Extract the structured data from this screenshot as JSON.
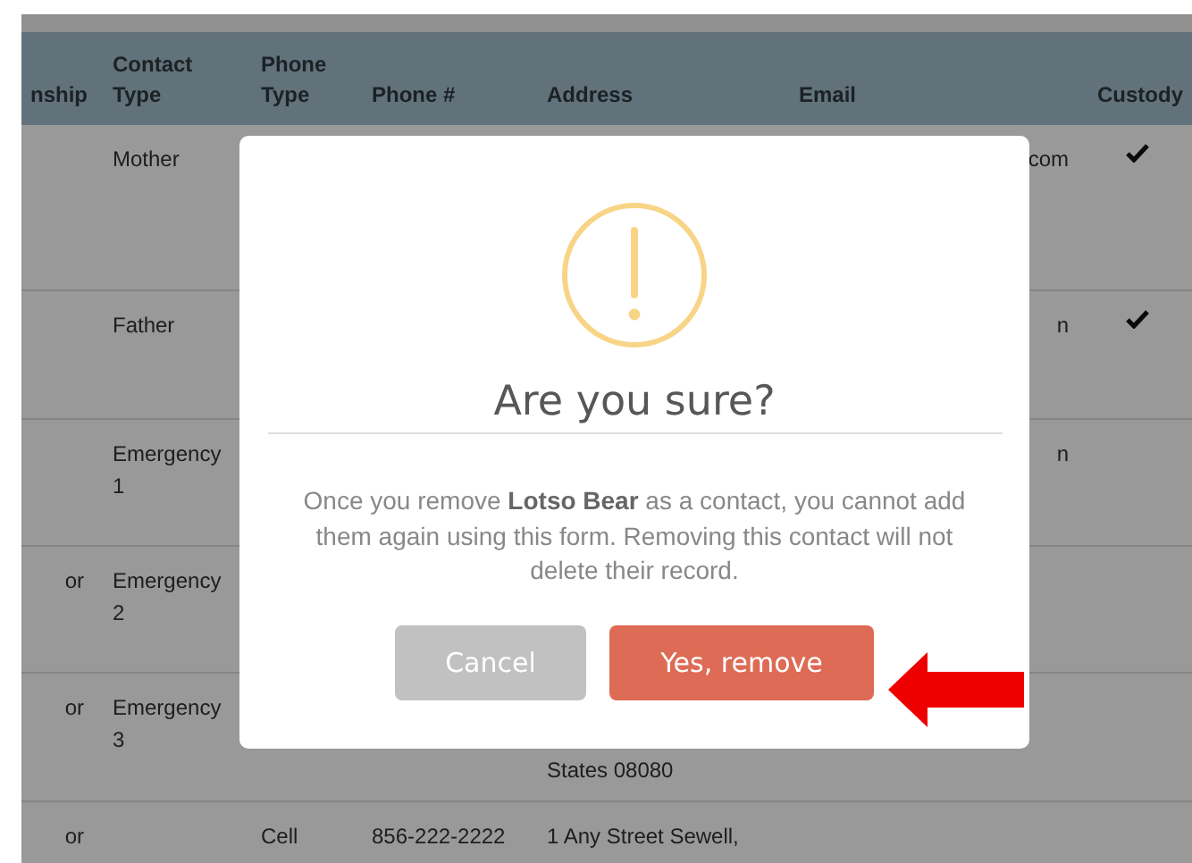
{
  "table": {
    "columns": [
      "nship",
      "Contact Type",
      "Phone Type",
      "Phone #",
      "Address",
      "Email",
      "Custody"
    ],
    "rows": [
      {
        "relationship": "",
        "contact_type": "Mother",
        "phone_type": "",
        "phone": "",
        "address": "",
        "email": "com",
        "custody": true
      },
      {
        "relationship": "",
        "contact_type": "Father",
        "phone_type": "",
        "phone": "",
        "address": "",
        "email": "n",
        "custody": true
      },
      {
        "relationship": "",
        "contact_type": "Emergency 1",
        "phone_type": "",
        "phone": "",
        "address": "",
        "email": "n",
        "custody": false
      },
      {
        "relationship": "or",
        "contact_type": "Emergency 2",
        "phone_type": "",
        "phone": "",
        "address": "",
        "email": "",
        "custody": false
      },
      {
        "relationship": "or",
        "contact_type": "Emergency 3",
        "phone_type": "",
        "phone": "",
        "address": "States 08080",
        "email": "",
        "custody": false
      },
      {
        "relationship": "or",
        "contact_type": "",
        "phone_type": "Cell",
        "phone": "856-222-2222",
        "address": "1 Any Street Sewell,",
        "email": "",
        "custody": false
      }
    ]
  },
  "dialog": {
    "title": "Are you sure?",
    "message": "Once you remove **Lotso Bear** as a contact, you cannot add them again using this form. Removing this contact will not delete their record.",
    "buttons": [
      {
        "label": "Cancel",
        "kind": "cancel"
      },
      {
        "label": "Yes, remove",
        "kind": "confirm"
      }
    ]
  }
}
